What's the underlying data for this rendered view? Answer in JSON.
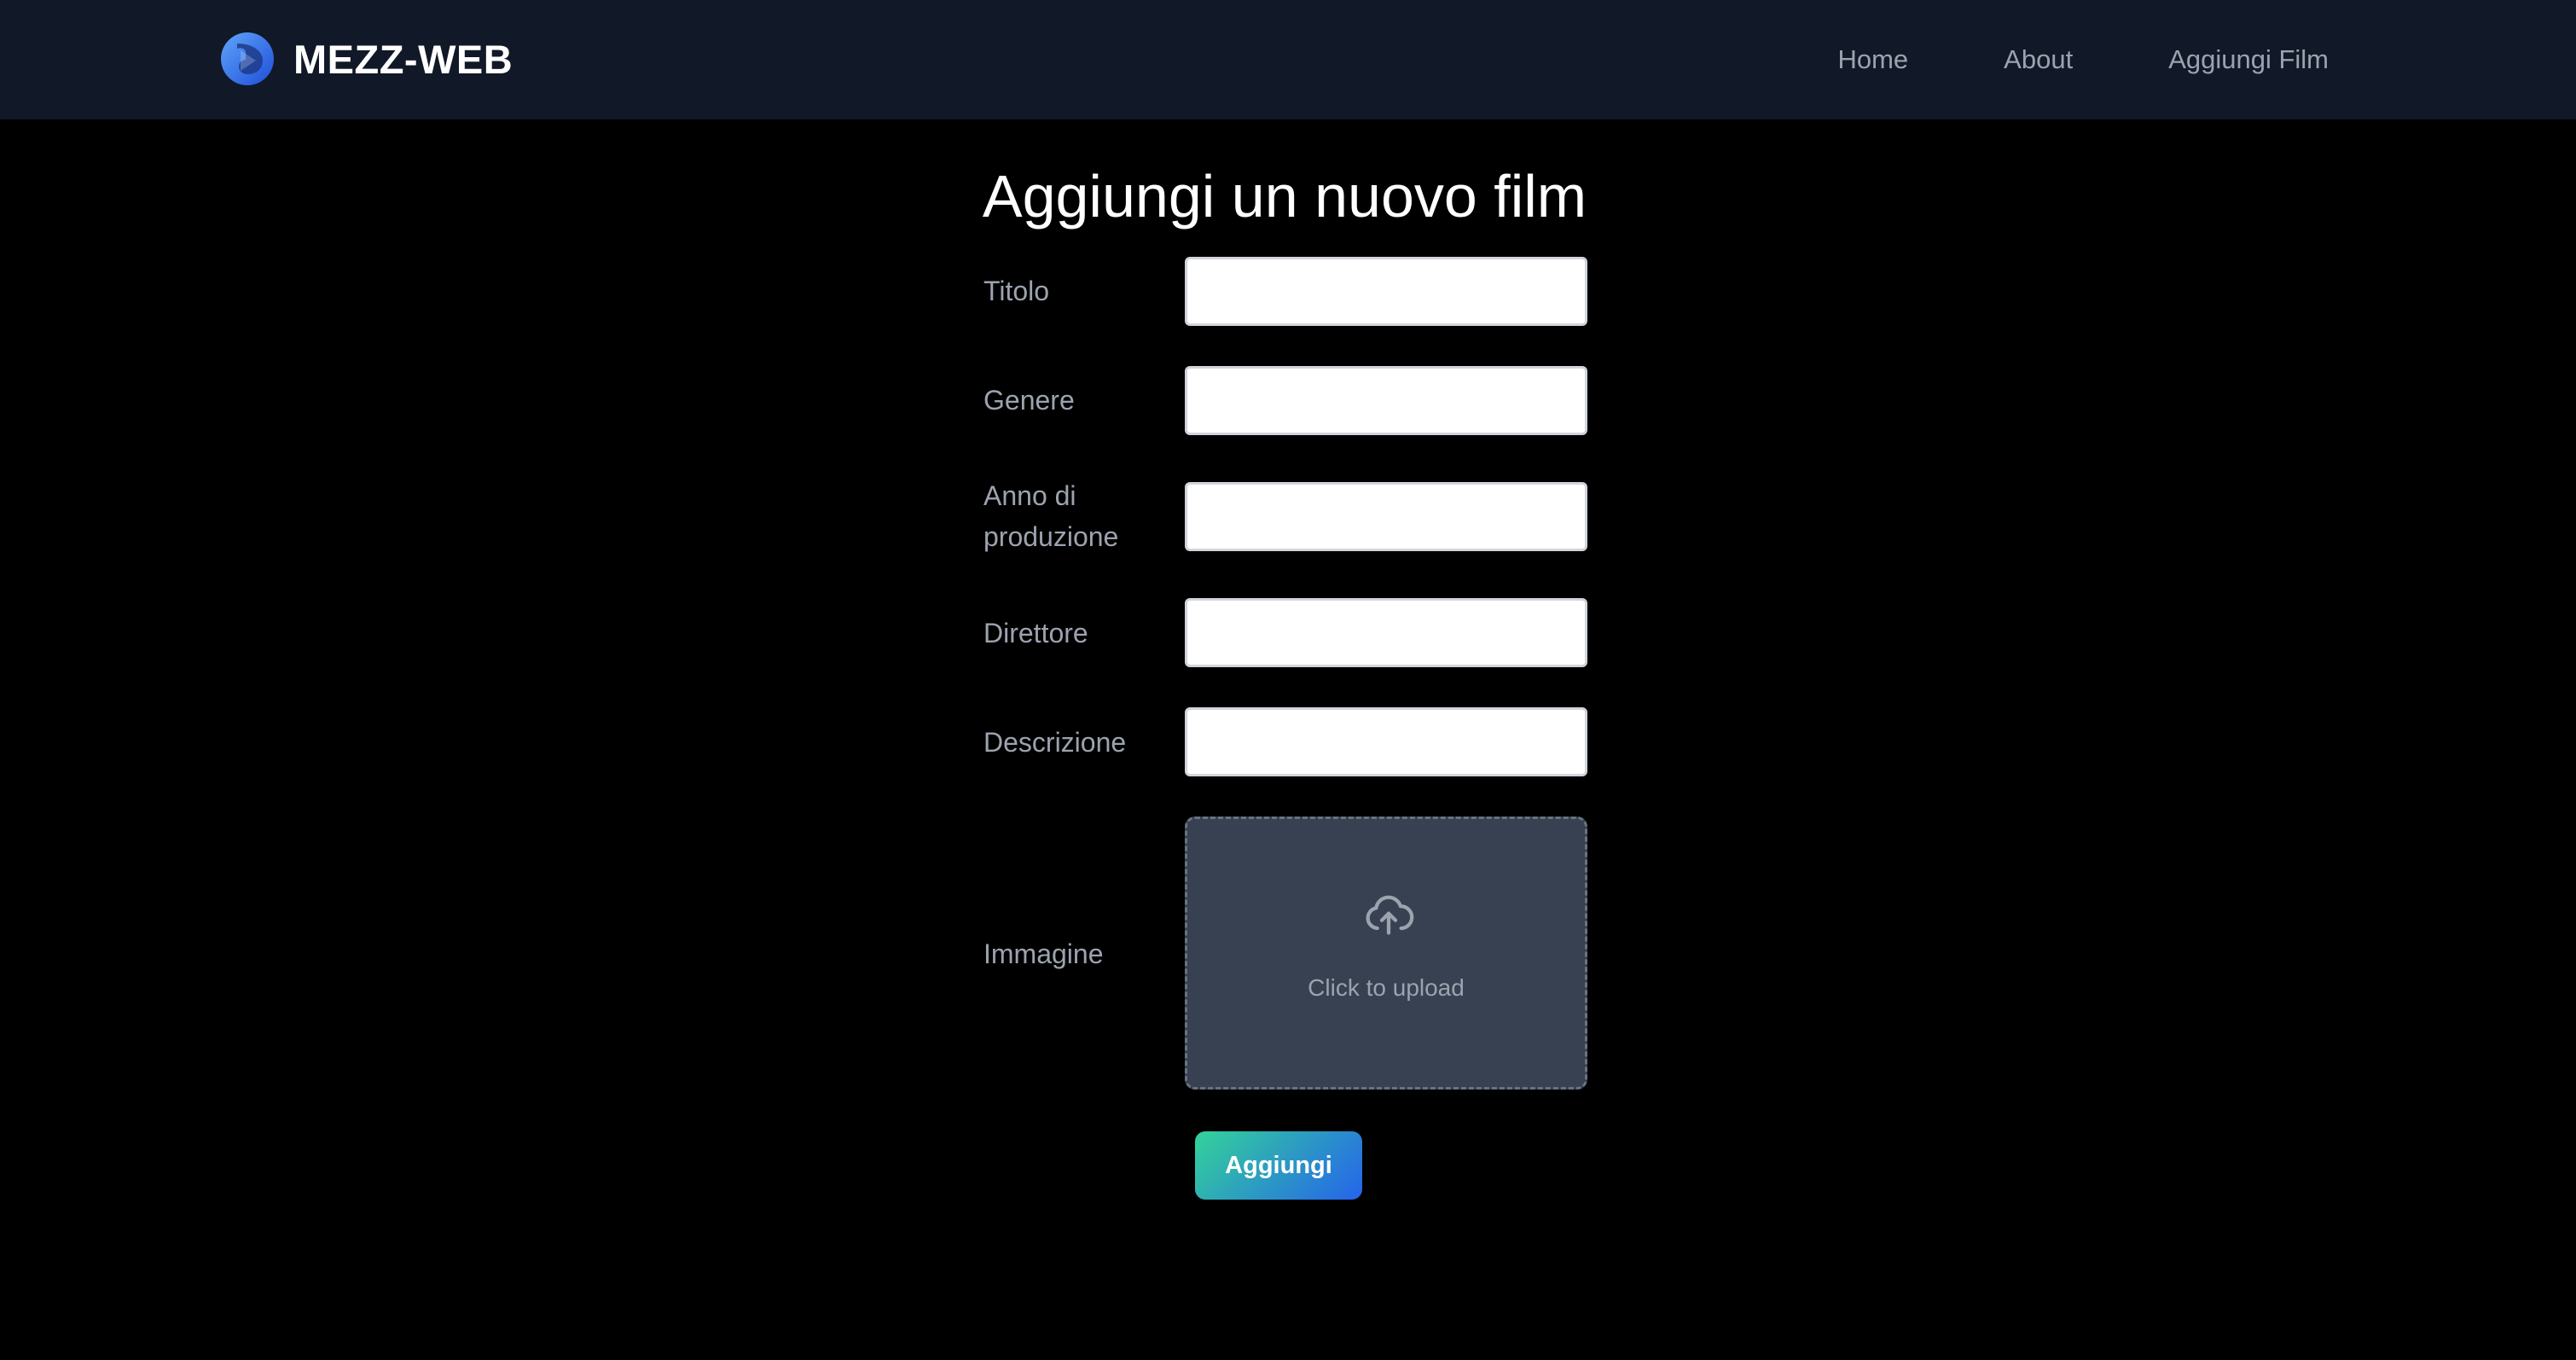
{
  "brand": {
    "name": "MEZZ-WEB",
    "logo_icon": "mezz-web-logo-icon",
    "logo_color": "#3b82f6"
  },
  "nav": {
    "links": [
      {
        "label": "Home"
      },
      {
        "label": "About"
      },
      {
        "label": "Aggiungi Film"
      }
    ]
  },
  "page": {
    "title": "Aggiungi un nuovo film"
  },
  "form": {
    "fields": [
      {
        "label": "Titolo",
        "value": "",
        "placeholder": ""
      },
      {
        "label": "Genere",
        "value": "",
        "placeholder": ""
      },
      {
        "label": "Anno di produzione",
        "value": "",
        "placeholder": ""
      },
      {
        "label": "Direttore",
        "value": "",
        "placeholder": ""
      },
      {
        "label": "Descrizione",
        "value": "",
        "placeholder": ""
      }
    ],
    "image": {
      "label": "Immagine",
      "upload_text": "Click to upload",
      "upload_icon": "cloud-upload-icon"
    },
    "submit_label": "Aggiungi"
  },
  "colors": {
    "navbar_bg": "#111827",
    "page_bg": "#000000",
    "button_gradient_start": "#34d399",
    "button_gradient_end": "#2563eb",
    "upload_bg": "#374151"
  }
}
